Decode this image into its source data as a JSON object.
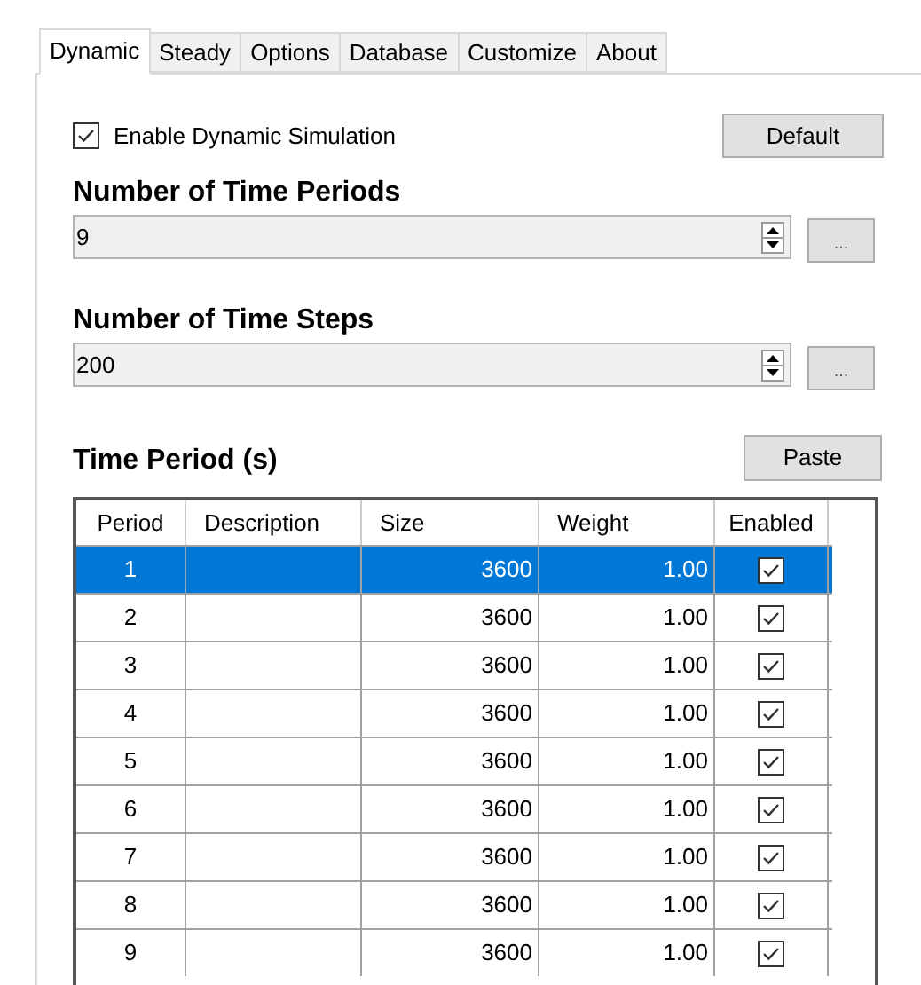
{
  "tabs": [
    {
      "label": "Dynamic",
      "selected": true
    },
    {
      "label": "Steady",
      "selected": false
    },
    {
      "label": "Options",
      "selected": false
    },
    {
      "label": "Database",
      "selected": false
    },
    {
      "label": "Customize",
      "selected": false
    },
    {
      "label": "About",
      "selected": false
    }
  ],
  "enable_checkbox": {
    "label": "Enable Dynamic Simulation",
    "checked": true
  },
  "default_button": "Default",
  "fields": [
    {
      "heading": "Number of Time Periods",
      "value": "9",
      "button": "..."
    },
    {
      "heading": "Number of Time Steps",
      "value": "200",
      "button": "..."
    }
  ],
  "table_heading": "Time Period (s)",
  "paste_button": "Paste",
  "table": {
    "columns": [
      "Period",
      "Description",
      "Size",
      "Weight",
      "Enabled"
    ],
    "rows": [
      {
        "period": "1",
        "description": "",
        "size": "3600",
        "weight": "1.00",
        "enabled": true,
        "selected": true
      },
      {
        "period": "2",
        "description": "",
        "size": "3600",
        "weight": "1.00",
        "enabled": true,
        "selected": false
      },
      {
        "period": "3",
        "description": "",
        "size": "3600",
        "weight": "1.00",
        "enabled": true,
        "selected": false
      },
      {
        "period": "4",
        "description": "",
        "size": "3600",
        "weight": "1.00",
        "enabled": true,
        "selected": false
      },
      {
        "period": "5",
        "description": "",
        "size": "3600",
        "weight": "1.00",
        "enabled": true,
        "selected": false
      },
      {
        "period": "6",
        "description": "",
        "size": "3600",
        "weight": "1.00",
        "enabled": true,
        "selected": false
      },
      {
        "period": "7",
        "description": "",
        "size": "3600",
        "weight": "1.00",
        "enabled": true,
        "selected": false
      },
      {
        "period": "8",
        "description": "",
        "size": "3600",
        "weight": "1.00",
        "enabled": true,
        "selected": false
      },
      {
        "period": "9",
        "description": "",
        "size": "3600",
        "weight": "1.00",
        "enabled": true,
        "selected": false
      }
    ]
  }
}
